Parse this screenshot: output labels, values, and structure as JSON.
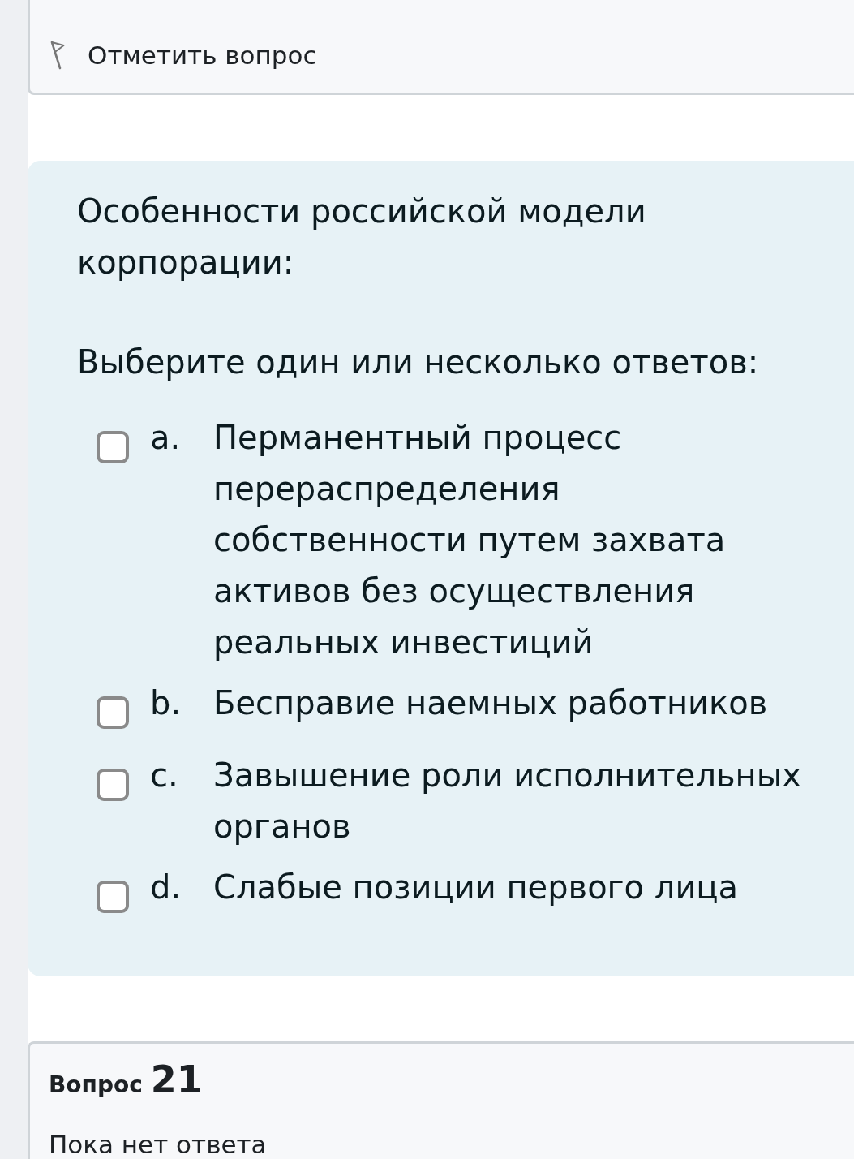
{
  "previous_question": {
    "flag_link": "Отметить вопрос"
  },
  "question": {
    "text": "Особенности российской модели корпорации:",
    "prompt": "Выберите один или несколько ответов:",
    "options": [
      {
        "letter": "a.",
        "text": "Перманентный процесс перераспределения собственности путем захвата активов без осуществления реальных инвестиций",
        "checked": false
      },
      {
        "letter": "b.",
        "text": "Бесправие наемных работников",
        "checked": false
      },
      {
        "letter": "c.",
        "text": "Завышение роли исполнительных органов",
        "checked": false
      },
      {
        "letter": "d.",
        "text": "Слабые позиции первого лица",
        "checked": false
      }
    ]
  },
  "next_question": {
    "label": "Вопрос",
    "number": "21",
    "status": "Пока нет ответа"
  }
}
